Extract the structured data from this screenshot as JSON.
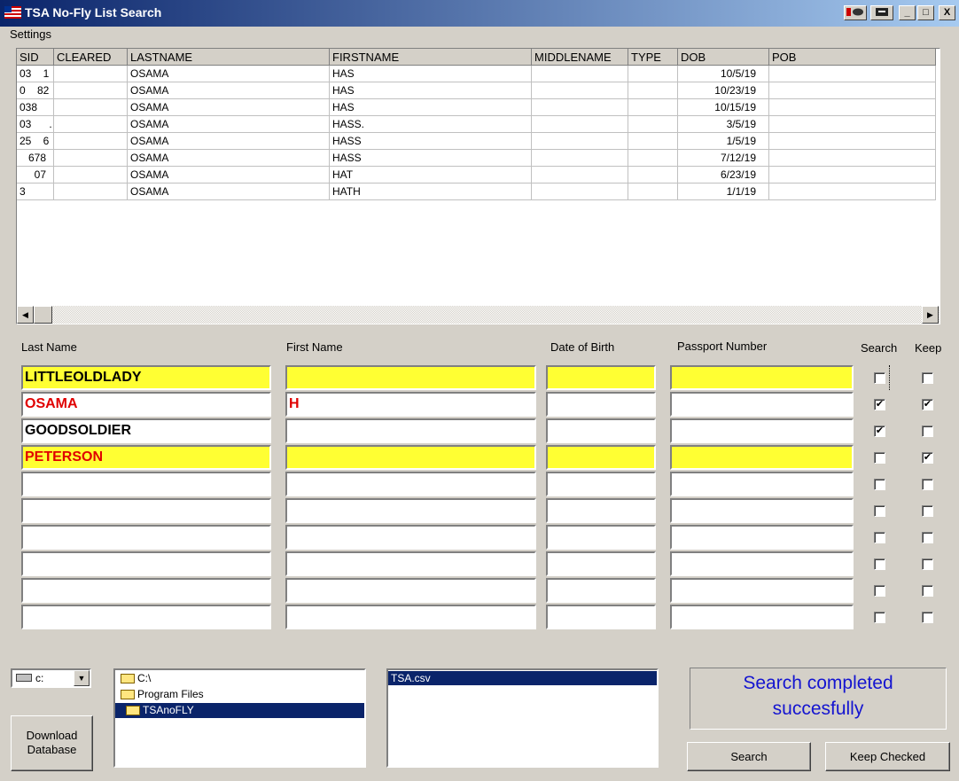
{
  "window": {
    "title": "TSA No-Fly List Search",
    "buttons": [
      "_",
      "□",
      "X"
    ]
  },
  "menu": {
    "settings": "Settings"
  },
  "grid": {
    "columns": [
      "SID",
      "CLEARED",
      "LASTNAME",
      "FIRSTNAME",
      "MIDDLENAME",
      "TYPE",
      "DOB",
      "POB"
    ],
    "rows": [
      {
        "sid": "03    1",
        "cleared": "",
        "lastname": "OSAMA",
        "firstname": "HAS",
        "middlename": "",
        "type": "",
        "dob": "10/5/19",
        "pob": ""
      },
      {
        "sid": "0    82",
        "cleared": "",
        "lastname": "OSAMA",
        "firstname": "HAS",
        "middlename": "",
        "type": "",
        "dob": "10/23/19",
        "pob": ""
      },
      {
        "sid": "038",
        "cleared": "",
        "lastname": "OSAMA",
        "firstname": "HAS",
        "middlename": "",
        "type": "",
        "dob": "10/15/19",
        "pob": ""
      },
      {
        "sid": "03      .",
        "cleared": "",
        "lastname": "OSAMA",
        "firstname": "HASS.",
        "middlename": "",
        "type": "",
        "dob": "3/5/19",
        "pob": ""
      },
      {
        "sid": "25    6",
        "cleared": "",
        "lastname": "OSAMA",
        "firstname": "HASS",
        "middlename": "",
        "type": "",
        "dob": "1/5/19",
        "pob": ""
      },
      {
        "sid": "   678",
        "cleared": "",
        "lastname": "OSAMA",
        "firstname": "HASS",
        "middlename": "",
        "type": "",
        "dob": "7/12/19",
        "pob": ""
      },
      {
        "sid": "     07",
        "cleared": "",
        "lastname": "OSAMA",
        "firstname": "HAT",
        "middlename": "",
        "type": "",
        "dob": "6/23/19",
        "pob": ""
      },
      {
        "sid": "3",
        "cleared": "",
        "lastname": "OSAMA",
        "firstname": "HATH",
        "middlename": "",
        "type": "",
        "dob": "1/1/19",
        "pob": ""
      }
    ]
  },
  "form": {
    "labels": {
      "last_name": "Last Name",
      "first_name": "First Name",
      "dob": "Date of Birth",
      "passport": "Passport Number",
      "search": "Search",
      "keep": "Keep"
    },
    "rows": [
      {
        "last": "LITTLEOLDLADY",
        "first": "",
        "dob": "",
        "passport": "",
        "search": false,
        "keep": false,
        "highlight": true,
        "red": false
      },
      {
        "last": "OSAMA",
        "first": "H",
        "dob": "",
        "passport": "",
        "search": true,
        "keep": true,
        "highlight": false,
        "red": true
      },
      {
        "last": "GOODSOLDIER",
        "first": "",
        "dob": "",
        "passport": "",
        "search": true,
        "keep": false,
        "highlight": false,
        "red": false
      },
      {
        "last": "PETERSON",
        "first": "",
        "dob": "",
        "passport": "",
        "search": false,
        "keep": true,
        "highlight": true,
        "red": true
      },
      {
        "last": "",
        "first": "",
        "dob": "",
        "passport": "",
        "search": false,
        "keep": false,
        "highlight": false,
        "red": false
      },
      {
        "last": "",
        "first": "",
        "dob": "",
        "passport": "",
        "search": false,
        "keep": false,
        "highlight": false,
        "red": false
      },
      {
        "last": "",
        "first": "",
        "dob": "",
        "passport": "",
        "search": false,
        "keep": false,
        "highlight": false,
        "red": false
      },
      {
        "last": "",
        "first": "",
        "dob": "",
        "passport": "",
        "search": false,
        "keep": false,
        "highlight": false,
        "red": false
      },
      {
        "last": "",
        "first": "",
        "dob": "",
        "passport": "",
        "search": false,
        "keep": false,
        "highlight": false,
        "red": false
      },
      {
        "last": "",
        "first": "",
        "dob": "",
        "passport": "",
        "search": false,
        "keep": false,
        "highlight": false,
        "red": false
      }
    ]
  },
  "drive": {
    "value": "c:",
    "icon": "drive-icon"
  },
  "directories": [
    {
      "name": "C:\\",
      "selected": false
    },
    {
      "name": "Program Files",
      "selected": false
    },
    {
      "name": "TSAnoFLY",
      "selected": true
    }
  ],
  "files": [
    {
      "name": "TSA.csv",
      "selected": true
    }
  ],
  "buttons": {
    "download": "Download Database",
    "search": "Search",
    "keep_checked": "Keep Checked"
  },
  "status": {
    "line1": "Search completed",
    "line2": "succesfully"
  },
  "colors": {
    "highlight": "#ffff33",
    "red_text": "#e00000",
    "status_text": "#1414d0",
    "selection": "#0a246a"
  }
}
